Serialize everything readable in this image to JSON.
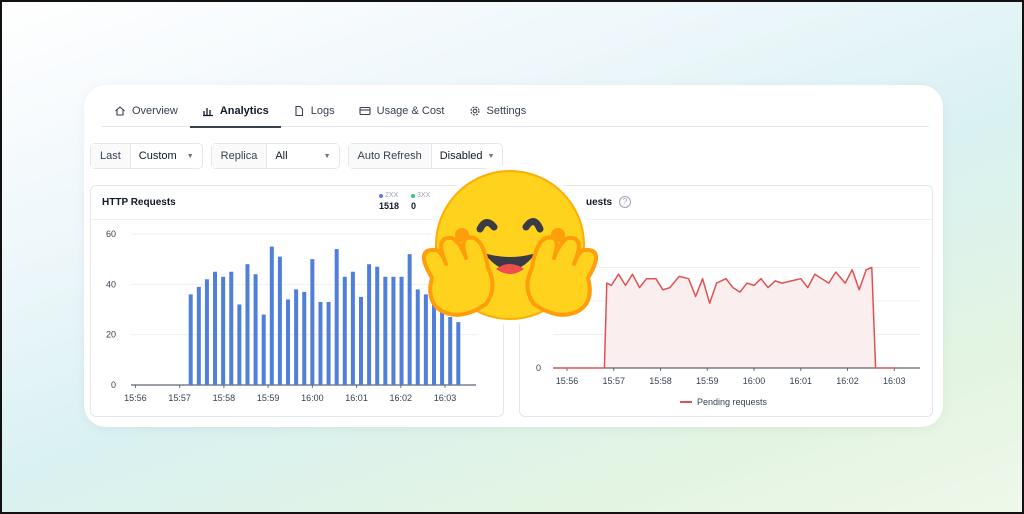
{
  "tabs": [
    {
      "label": "Overview",
      "icon": "home-icon",
      "active": false
    },
    {
      "label": "Analytics",
      "icon": "analytics-icon",
      "active": true
    },
    {
      "label": "Logs",
      "icon": "file-icon",
      "active": false
    },
    {
      "label": "Usage & Cost",
      "icon": "credit-card-icon",
      "active": false
    },
    {
      "label": "Settings",
      "icon": "gear-icon",
      "active": false
    }
  ],
  "filters": {
    "last_label": "Last",
    "last_value": "Custom",
    "replica_label": "Replica",
    "replica_value": "All",
    "refresh_label": "Auto Refresh",
    "refresh_value": "Disabled"
  },
  "colors": {
    "bar": "#4f7fd9",
    "line": "#e05252",
    "area": "#fbeeee",
    "status_2xx": "#4f7fd9",
    "status_3xx": "#3bbf8f"
  },
  "http_panel": {
    "title": "HTTP Requests",
    "stats": [
      {
        "name": "2XX",
        "value": "1518"
      },
      {
        "name": "3XX",
        "value": "0"
      }
    ]
  },
  "pending_panel": {
    "title": "uests",
    "legend": "Pending requests"
  },
  "chart_data": [
    {
      "type": "bar",
      "title": "HTTP Requests",
      "ylim": [
        0,
        60
      ],
      "yticks": [
        "0",
        "20",
        "40",
        "60"
      ],
      "xticks": [
        "15:56",
        "15:57",
        "15:58",
        "15:59",
        "16:00",
        "16:01",
        "16:02",
        "16:03"
      ],
      "series": [
        {
          "name": "2XX",
          "values": [
            36,
            39,
            42,
            45,
            43,
            45,
            32,
            48,
            44,
            28,
            55,
            51,
            34,
            38,
            37,
            50,
            33,
            33,
            54,
            43,
            45,
            35,
            48,
            47,
            43,
            43,
            43,
            52,
            38,
            36,
            33,
            31,
            27,
            25
          ]
        }
      ],
      "bar_start_minute": 1.35,
      "bar_end_minute": 7.4
    },
    {
      "type": "area",
      "title": "Pending requests",
      "xticks": [
        "15:56",
        "15:57",
        "15:58",
        "15:59",
        "16:00",
        "16:01",
        "16:02",
        "16:03"
      ],
      "yticks": [
        "0"
      ],
      "series": [
        {
          "name": "Pending requests",
          "values": [
            0,
            0,
            38,
            37,
            42,
            37,
            42,
            36,
            40,
            40,
            35,
            36,
            41,
            40,
            32,
            40,
            29,
            38,
            40,
            36,
            34,
            38,
            37,
            40,
            36,
            39,
            38,
            39,
            40,
            36,
            42,
            40,
            38,
            43,
            38,
            44,
            35,
            44,
            45,
            0,
            0
          ]
        }
      ],
      "x_minutes": [
        0,
        1.1,
        1.15,
        1.25,
        1.4,
        1.55,
        1.7,
        1.85,
        2.0,
        2.2,
        2.35,
        2.5,
        2.7,
        2.9,
        3.05,
        3.2,
        3.35,
        3.5,
        3.7,
        3.85,
        4.0,
        4.15,
        4.3,
        4.45,
        4.6,
        4.75,
        4.9,
        5.1,
        5.3,
        5.45,
        5.6,
        5.75,
        5.9,
        6.05,
        6.25,
        6.4,
        6.55,
        6.7,
        6.82,
        6.9,
        7.3
      ]
    }
  ]
}
